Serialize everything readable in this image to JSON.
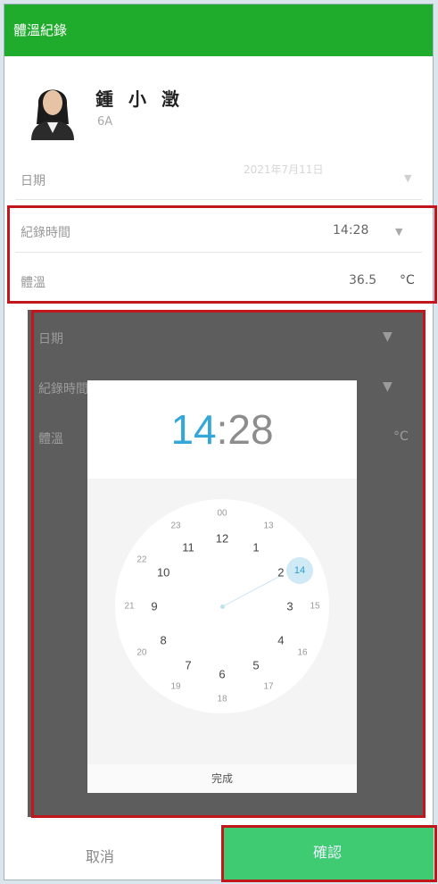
{
  "header": {
    "title": "體溫紀錄"
  },
  "profile": {
    "name": "鍾 小 澂",
    "class": "6A"
  },
  "form": {
    "date": {
      "label": "日期",
      "value": "2021年7月11日"
    },
    "record_time": {
      "label": "紀錄時間",
      "value": "14:28"
    },
    "temperature": {
      "label": "體溫",
      "value": "36.5",
      "unit": "°C"
    }
  },
  "time_picker": {
    "hour": "14",
    "separator": ":",
    "minute": "28",
    "outer_numbers": [
      "12",
      "1",
      "2",
      "3",
      "4",
      "5",
      "6",
      "7",
      "8",
      "9",
      "10",
      "11"
    ],
    "inner_numbers": [
      "00",
      "13",
      "14",
      "15",
      "16",
      "17",
      "18",
      "19",
      "20",
      "21",
      "22",
      "23"
    ],
    "selected": "14",
    "done_label": "完成"
  },
  "footer": {
    "cancel_label": "取消",
    "confirm_label": "確認"
  },
  "colors": {
    "header_bg": "#1fab2c",
    "accent_blue": "#33a7d8",
    "confirm_bg": "#3ecb72",
    "highlight_border": "#c0161c"
  }
}
